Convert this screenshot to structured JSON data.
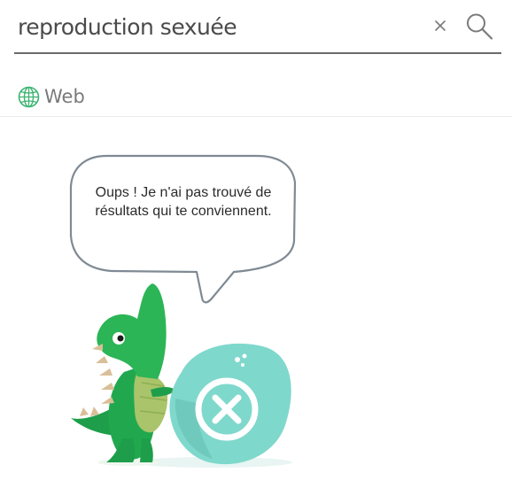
{
  "search": {
    "query": "reproduction sexuée",
    "clear_icon": "close-icon",
    "search_icon": "magnifier-icon"
  },
  "tabs": [
    {
      "label": "Web",
      "icon": "globe-icon",
      "active": true
    }
  ],
  "empty_state": {
    "message": "Oups ! Je n'ai pas trouvé de résultats qui te conviennent.",
    "mascot": "green-dinosaur",
    "badge_icon": "close-circle-icon"
  },
  "colors": {
    "globe": "#3cb371",
    "dino_green": "#1fa84f",
    "badge_teal": "#7fd8cc",
    "underline": "#6b6b6b"
  }
}
